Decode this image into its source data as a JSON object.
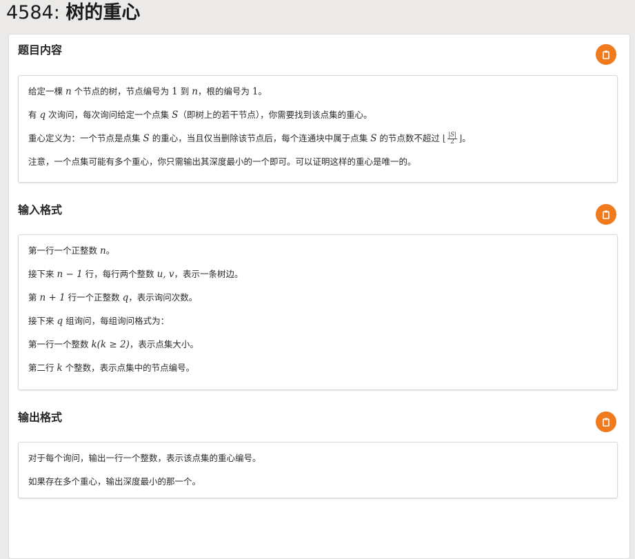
{
  "header": {
    "problem_id": "4584:",
    "problem_name": "树的重心"
  },
  "sections": {
    "description": {
      "title": "题目内容",
      "copy_icon": "clipboard-icon",
      "p1": {
        "a": "给定一棵 ",
        "n": "n",
        "b": " 个节点的树，节点编号为 ",
        "one": "1",
        "c": " 到 ",
        "n2": "n",
        "d": "，根的编号为 ",
        "one2": "1",
        "e": "。"
      },
      "p2": {
        "a": "有 ",
        "q": "q",
        "b": " 次询问，每次询问给定一个点集 ",
        "S": "S",
        "c": "（即树上的若干节点），你需要找到该点集的重心。"
      },
      "p3": {
        "a": "重心定义为：一个节点是点集 ",
        "S": "S",
        "b": " 的重心，当且仅当删除该节点后，每个连通块中属于点集 ",
        "S2": "S",
        "c": " 的节点数不超过 ",
        "frac_num": "|S|",
        "frac_den": "2",
        "d": "。"
      },
      "p4": {
        "a": "注意，一个点集可能有多个重心，你只需输出其深度最小的一个即可。可以证明这样的重心是唯一的。"
      }
    },
    "input": {
      "title": "输入格式",
      "copy_icon": "clipboard-icon",
      "p1": {
        "a": "第一行一个正整数 ",
        "n": "n",
        "b": "。"
      },
      "p2": {
        "a": "接下来 ",
        "expr": "n − 1",
        "b": " 行，每行两个整数 ",
        "uv": "u, v",
        "c": "，表示一条树边。"
      },
      "p3": {
        "a": "第 ",
        "expr": "n + 1",
        "b": " 行一个正整数 ",
        "q": "q",
        "c": "，表示询问次数。"
      },
      "p4": {
        "a": "接下来 ",
        "q": "q",
        "b": " 组询问，每组询问格式为："
      },
      "p5": {
        "a": "第一行一个整数 ",
        "expr": "k(k ≥ 2)",
        "b": "，表示点集大小。"
      },
      "p6": {
        "a": "第二行 ",
        "k": "k",
        "b": " 个整数，表示点集中的节点编号。"
      }
    },
    "output": {
      "title": "输出格式",
      "copy_icon": "clipboard-icon",
      "p1": {
        "a": "对于每个询问，输出一行一个整数，表示该点集的重心编号。"
      },
      "p2": {
        "a": "如果存在多个重心，输出深度最小的那一个。"
      }
    }
  },
  "colors": {
    "accent": "#f07a1e",
    "background": "#ebeae8"
  }
}
